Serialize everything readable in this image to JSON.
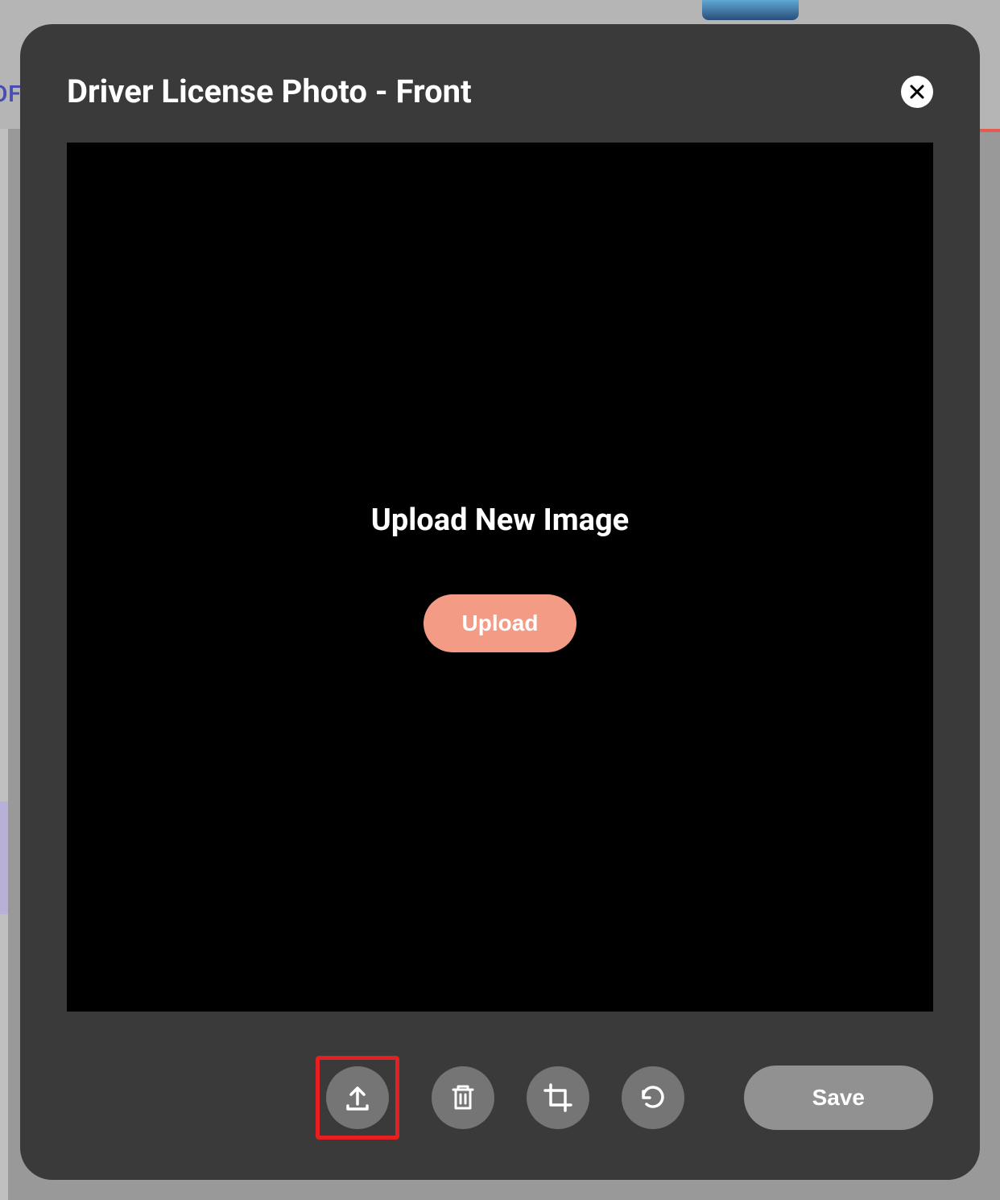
{
  "modal": {
    "title": "Driver License Photo - Front",
    "upload_prompt": "Upload New Image",
    "upload_button_label": "Upload",
    "save_button_label": "Save"
  },
  "toolbar": {
    "icons": {
      "upload": "upload-icon",
      "delete": "trash-icon",
      "crop": "crop-icon",
      "rotate": "rotate-ccw-icon"
    }
  },
  "backdrop": {
    "partial_text": "OF"
  },
  "colors": {
    "modal_bg": "#3a3a3a",
    "accent": "#f39b84",
    "highlight_border": "#e62020",
    "tool_bg": "#757575",
    "save_bg": "#919191"
  }
}
